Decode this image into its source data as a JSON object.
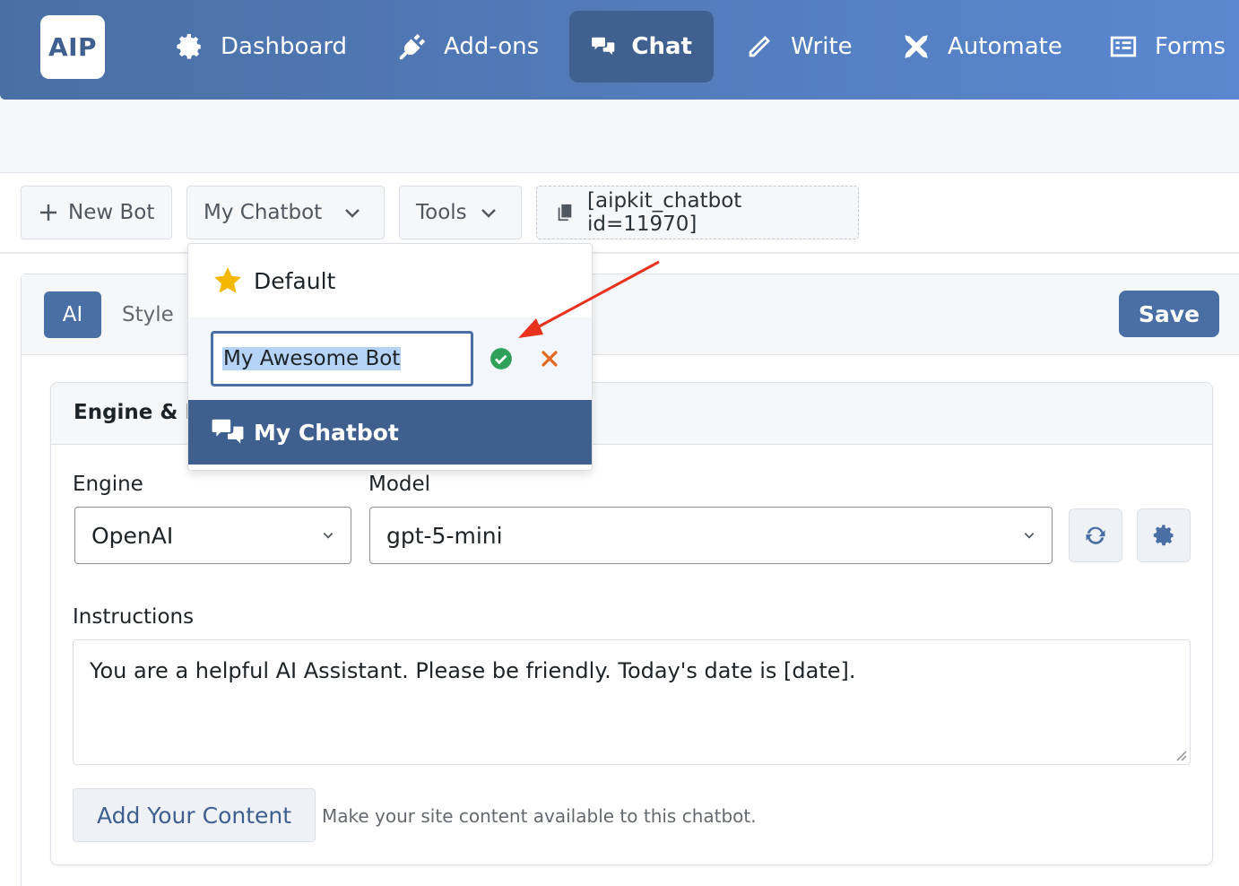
{
  "nav": {
    "logo": "AIP",
    "items": [
      {
        "label": "Dashboard",
        "icon": "gear-icon"
      },
      {
        "label": "Add-ons",
        "icon": "plug-icon"
      },
      {
        "label": "Chat",
        "icon": "chat-bubbles-icon",
        "active": true
      },
      {
        "label": "Write",
        "icon": "pencil-icon"
      },
      {
        "label": "Automate",
        "icon": "plane-icon"
      },
      {
        "label": "Forms",
        "icon": "form-icon"
      }
    ]
  },
  "toolbar": {
    "new_bot": "New Bot",
    "bot_select": "My Chatbot",
    "tools": "Tools",
    "shortcode": "[aipkit_chatbot id=11970]"
  },
  "tabs": {
    "ai": "AI",
    "style": "Style",
    "save": "Save"
  },
  "dropdown": {
    "default_label": "Default",
    "rename_value": "My Awesome Bot",
    "active_label": "My Chatbot"
  },
  "card": {
    "title": "Engine & M",
    "engine_label": "Engine",
    "engine_value": "OpenAI",
    "model_label": "Model",
    "model_value": "gpt-5-mini",
    "instructions_label": "Instructions",
    "instructions_value": "You are a helpful AI Assistant. Please be friendly. Today's date is [date].",
    "add_content": "Add Your Content",
    "hint": "Make your site content available to this chatbot."
  },
  "colors": {
    "nav_start": "#4a6fa5",
    "nav_end": "#5a87cf",
    "accent": "#4a6fa5",
    "active_row": "#3f5f8f",
    "confirm": "#2ea05a",
    "cancel": "#e06a1e",
    "annotation_arrow": "#e8321e"
  }
}
